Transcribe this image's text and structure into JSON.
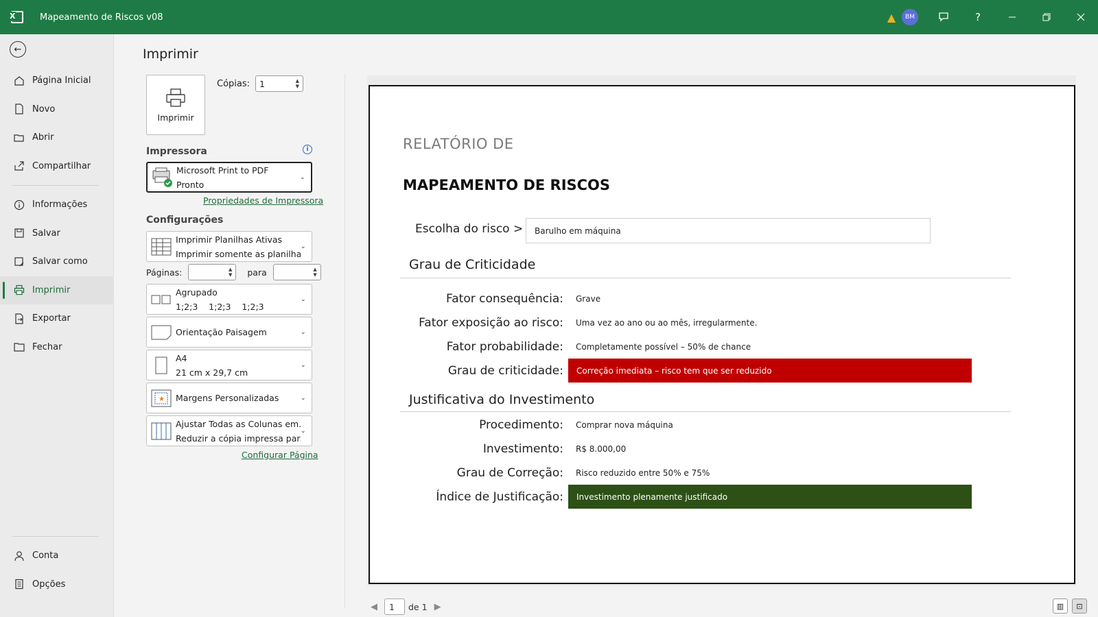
{
  "window": {
    "title": "Mapeamento de Riscos v08",
    "user_initials": "BM",
    "help_label": "?"
  },
  "sidebar": {
    "top": [
      {
        "label": "Página Inicial",
        "icon": "home-icon"
      },
      {
        "label": "Novo",
        "icon": "new-file-icon"
      },
      {
        "label": "Abrir",
        "icon": "folder-open-icon"
      },
      {
        "label": "Compartilhar",
        "icon": "share-icon"
      }
    ],
    "middle": [
      {
        "label": "Informações",
        "icon": "info-icon"
      },
      {
        "label": "Salvar",
        "icon": "save-icon"
      },
      {
        "label": "Salvar como",
        "icon": "save-as-icon"
      },
      {
        "label": "Imprimir",
        "icon": "printer-icon",
        "active": true
      },
      {
        "label": "Exportar",
        "icon": "export-icon"
      },
      {
        "label": "Fechar",
        "icon": "folder-close-icon"
      }
    ],
    "bottom": [
      {
        "label": "Conta",
        "icon": "account-icon"
      },
      {
        "label": "Opções",
        "icon": "options-icon"
      }
    ]
  },
  "print": {
    "heading": "Imprimir",
    "print_button": "Imprimir",
    "copies_label": "Cópias:",
    "copies_value": "1",
    "printer_section": "Impressora",
    "printer_name": "Microsoft Print to PDF",
    "printer_status": "Pronto",
    "printer_properties": "Propriedades de Impressora",
    "settings_section": "Configurações",
    "what_line1": "Imprimir Planilhas Ativas",
    "what_line2": "Imprimir somente as planilhas...",
    "pages_label": "Páginas:",
    "pages_to": "para",
    "collate_line1": "Agrupado",
    "collate_line2": "1;2;3    1;2;3    1;2;3",
    "orientation": "Orientação Paisagem",
    "paper_line1": "A4",
    "paper_line2": "21 cm x 29,7 cm",
    "margins": "Margens Personalizadas",
    "scaling_line1": "Ajustar Todas as Colunas em...",
    "scaling_line2": "Reduzir a cópia impressa par...",
    "page_setup": "Configurar Página"
  },
  "preview": {
    "subtitle": "RELATÓRIO DE",
    "title": "MAPEAMENTO DE RISCOS",
    "choose_label": "Escolha do risco >",
    "choose_value": "Barulho em máquina",
    "section1": "Grau de Criticidade",
    "rows1": [
      {
        "label": "Fator consequência:",
        "value": "Grave"
      },
      {
        "label": "Fator exposição ao risco:",
        "value": "Uma vez ao ano ou ao mês, irregularmente."
      },
      {
        "label": "Fator probabilidade:",
        "value": "Completamente possível – 50% de chance"
      },
      {
        "label": "Grau de criticidade:",
        "value": "Correção imediata – risco tem que ser reduzido"
      }
    ],
    "section2": "Justificativa do Investimento",
    "rows2": [
      {
        "label": "Procedimento:",
        "value": "Comprar nova máquina"
      },
      {
        "label": "Investimento:",
        "value": "R$ 8.000,00"
      },
      {
        "label": "Grau de Correção:",
        "value": "Risco reduzido entre 50% e 75%"
      },
      {
        "label": "Índice de Justificação:",
        "value": "Investimento plenamente justificado"
      }
    ],
    "critical_color": "#c00000",
    "justified_color": "#2d5016"
  },
  "pager": {
    "current": "1",
    "of_label": "de 1"
  }
}
